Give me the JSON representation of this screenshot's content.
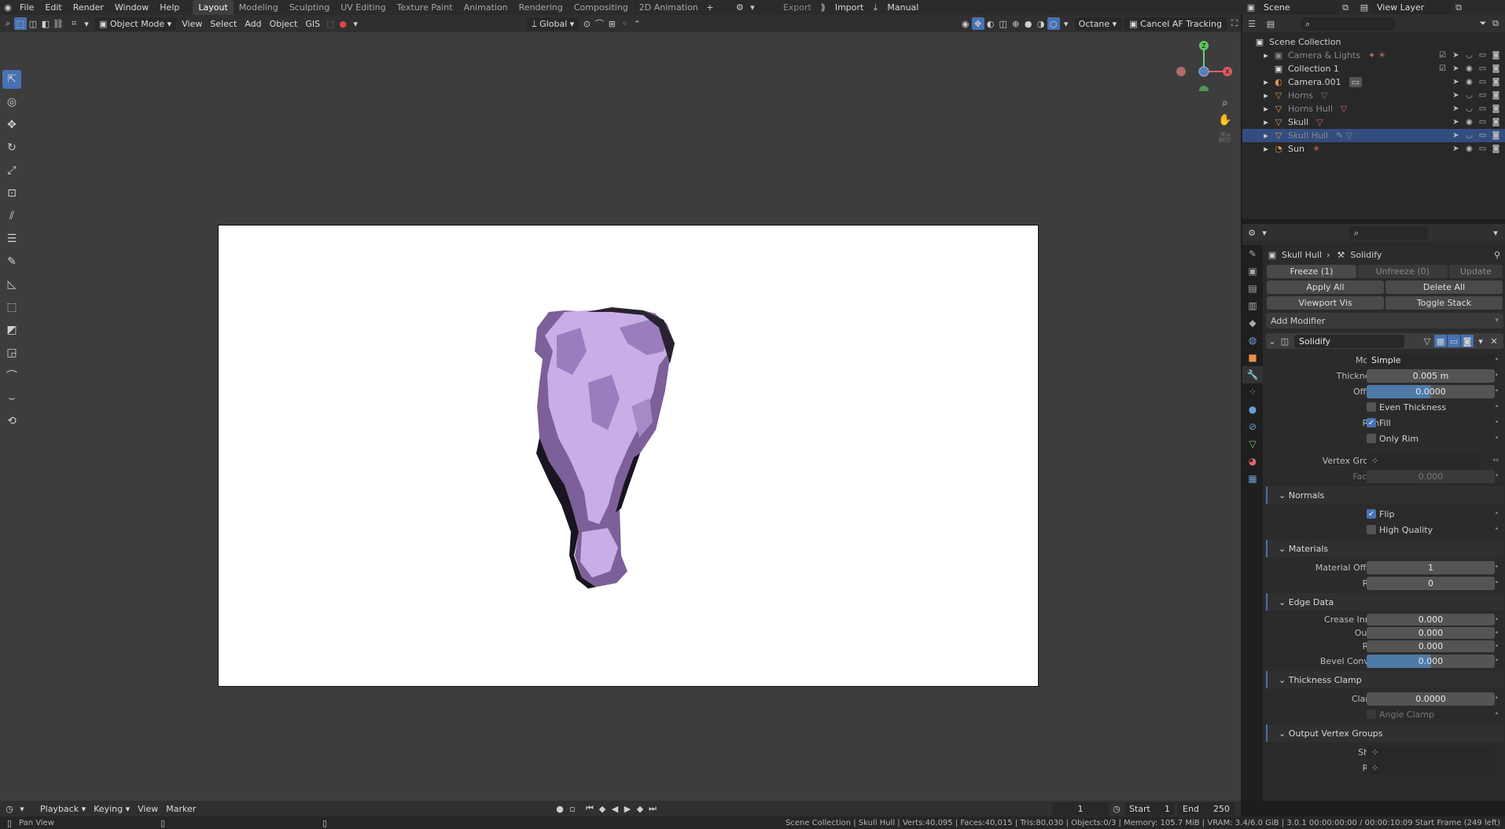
{
  "menu": [
    "File",
    "Edit",
    "Render",
    "Window",
    "Help"
  ],
  "workspaces": [
    "Layout",
    "Modeling",
    "Sculpting",
    "UV Editing",
    "Texture Paint",
    "Animation",
    "Rendering",
    "Compositing",
    "2D Animation"
  ],
  "topright": {
    "export": "Export",
    "import": "Import",
    "manual": "Manual",
    "scene": "Scene",
    "view_layer": "View Layer"
  },
  "viewport_header": {
    "mode": "Object Mode",
    "view": "View",
    "select": "Select",
    "add": "Add",
    "object": "Object",
    "gis": "GIS",
    "orientation": "Global",
    "renderer": "Octane",
    "cancel_af": "Cancel AF Tracking"
  },
  "gizmo": {
    "z": "Z",
    "x": "X"
  },
  "outliner": {
    "root": "Scene Collection",
    "items": [
      {
        "name": "Camera & Lights",
        "dim": true
      },
      {
        "name": "Collection 1",
        "dim": false
      },
      {
        "name": "Camera.001",
        "dim": false
      },
      {
        "name": "Horns",
        "dim": true
      },
      {
        "name": "Horns Hull",
        "dim": true
      },
      {
        "name": "Skull",
        "dim": false
      },
      {
        "name": "Skull Hull",
        "dim": true,
        "selected": true
      },
      {
        "name": "Sun",
        "dim": false
      }
    ]
  },
  "properties": {
    "breadcrumb_object": "Skull Hull",
    "breadcrumb_modifier": "Solidify",
    "freeze": "Freeze (1)",
    "unfreeze": "Unfreeze (0)",
    "update": "Update",
    "apply_all": "Apply All",
    "delete_all": "Delete All",
    "viewport_vis": "Viewport Vis",
    "toggle_stack": "Toggle Stack",
    "add_modifier": "Add Modifier",
    "modifier_name": "Solidify",
    "mode_label": "Mode",
    "mode_value": "Simple",
    "thickness_label": "Thickness",
    "thickness_value": "0.005 m",
    "offset_label": "Offset",
    "offset_value": "0.0000",
    "even_thickness": "Even Thickness",
    "rim_label": "Rim",
    "fill": "Fill",
    "only_rim": "Only Rim",
    "vertex_group_label": "Vertex Group",
    "factor_label": "Factor",
    "factor_value": "0.000",
    "normals": "Normals",
    "flip": "Flip",
    "high_quality": "High Quality",
    "materials": "Materials",
    "material_offset_label": "Material Offset",
    "material_offset_value": "1",
    "mat_rim_label": "Rim",
    "mat_rim_value": "0",
    "edge_data": "Edge Data",
    "crease_inner_label": "Crease Inner",
    "crease_inner_value": "0.000",
    "outer_label": "Outer",
    "outer_value": "0.000",
    "ed_rim_label": "Rim",
    "ed_rim_value": "0.000",
    "bevel_convex_label": "Bevel Convex",
    "bevel_convex_value": "0.000",
    "thickness_clamp": "Thickness Clamp",
    "clamp_label": "Clamp",
    "clamp_value": "0.0000",
    "angle_clamp": "Angle Clamp",
    "output_vertex_groups": "Output Vertex Groups",
    "shell_label": "Shell",
    "ovg_rim_label": "Rim"
  },
  "timeline": {
    "playback": "Playback",
    "keying": "Keying",
    "view": "View",
    "marker": "Marker",
    "frame": "1",
    "start_label": "Start",
    "start": "1",
    "end_label": "End",
    "end": "250"
  },
  "status": {
    "left": "Pan View",
    "right": "Scene Collection | Skull Hull | Verts:40,095 | Faces:40,015 | Tris:80,030 | Objects:0/3 | Memory: 105.7 MiB | VRAM: 3.4/6.0 GiB | 3.0.1   00:00:00:00 / 00:00:10:09  Start Frame (249 left)"
  }
}
